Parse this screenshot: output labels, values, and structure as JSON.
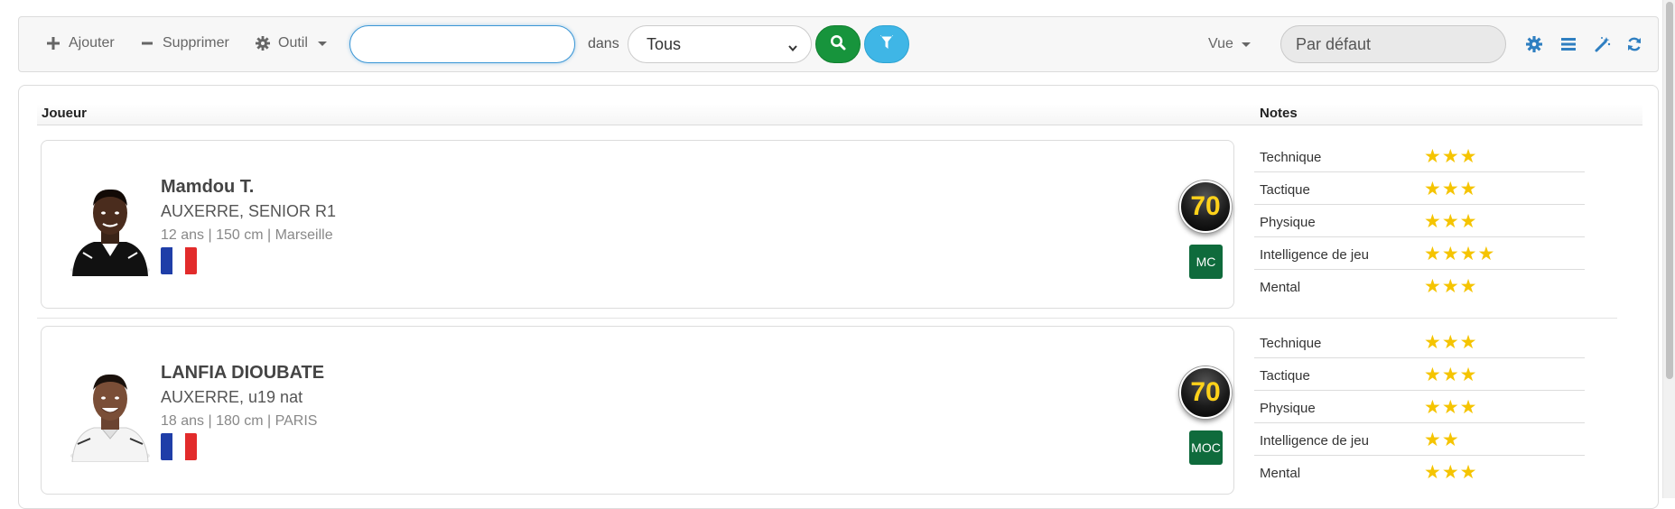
{
  "toolbar": {
    "add_label": "Ajouter",
    "delete_label": "Supprimer",
    "tool_label": "Outil",
    "search_value": "",
    "in_label": "dans",
    "scope_select": "Tous",
    "view_label": "Vue",
    "view_select": "Par défaut"
  },
  "table": {
    "col_player": "Joueur",
    "col_notes": "Notes"
  },
  "players": [
    {
      "name": "Mamdou T.",
      "club": "AUXERRE, SENIOR R1",
      "info": "12 ans | 150 cm | Marseille",
      "rating": "70",
      "position": "MC",
      "notes": [
        {
          "label": "Technique",
          "stars": "★★★"
        },
        {
          "label": "Tactique",
          "stars": "★★★"
        },
        {
          "label": "Physique",
          "stars": "★★★"
        },
        {
          "label": "Intelligence de jeu",
          "stars": "★★★★"
        },
        {
          "label": "Mental",
          "stars": "★★★"
        }
      ]
    },
    {
      "name": "LANFIA DIOUBATE",
      "club": "AUXERRE, u19 nat",
      "info": "18 ans | 180 cm | PARIS",
      "rating": "70",
      "position": "MOC",
      "notes": [
        {
          "label": "Technique",
          "stars": "★★★"
        },
        {
          "label": "Tactique",
          "stars": "★★★"
        },
        {
          "label": "Physique",
          "stars": "★★★"
        },
        {
          "label": "Intelligence de jeu",
          "stars": "★★"
        },
        {
          "label": "Mental",
          "stars": "★★★"
        }
      ]
    }
  ],
  "colors": {
    "search_button": "#17943c",
    "filter_button": "#3fb6e6",
    "accent_icons": "#2f7fc1",
    "rating_text": "#ffd21a",
    "position_badge": "#0f6b3c",
    "stars": "#f5c400"
  },
  "icons": {
    "add": "plus-icon",
    "delete": "minus-icon",
    "tool": "gear-icon",
    "search": "search-icon",
    "filter": "filter-icon",
    "settings": "gear-icon",
    "list": "list-icon",
    "magic": "magic-wand-icon",
    "refresh": "refresh-icon"
  }
}
